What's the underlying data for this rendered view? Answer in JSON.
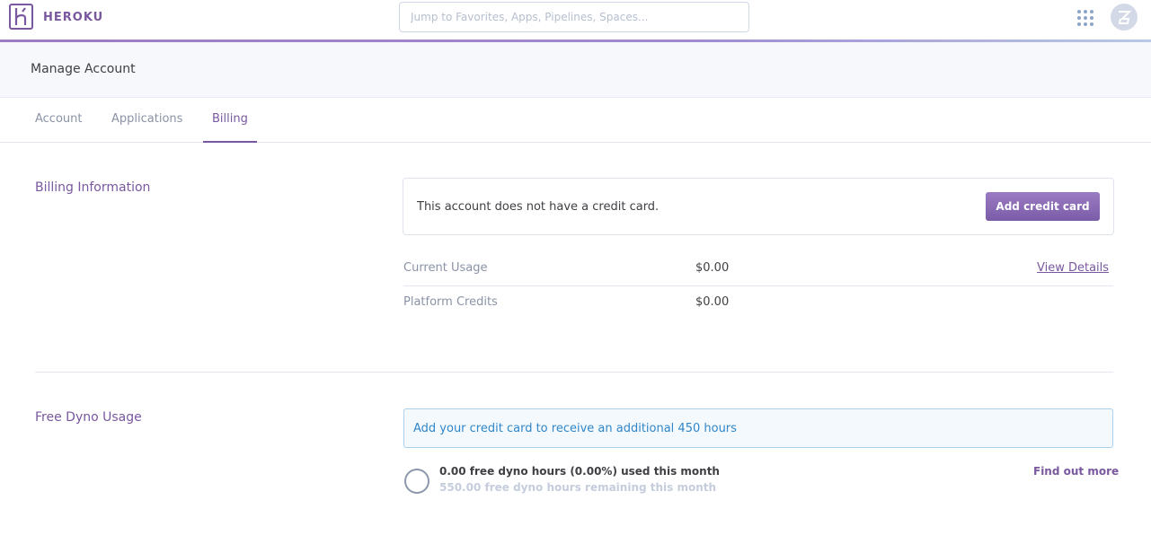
{
  "nav": {
    "brand": "HEROKU",
    "search_placeholder": "Jump to Favorites, Apps, Pipelines, Spaces...",
    "apps_icon": "grid-icon",
    "avatar_icon": "user-avatar-icon"
  },
  "header": {
    "title": "Manage Account"
  },
  "tabs": [
    {
      "label": "Account",
      "active": false
    },
    {
      "label": "Applications",
      "active": false
    },
    {
      "label": "Billing",
      "active": true
    }
  ],
  "billing": {
    "section_title": "Billing Information",
    "no_card_text": "This account does not have a credit card.",
    "add_card_label": "Add credit card",
    "rows": [
      {
        "label": "Current Usage",
        "value": "$0.00",
        "link": "View Details"
      },
      {
        "label": "Platform Credits",
        "value": "$0.00"
      }
    ]
  },
  "dyno": {
    "section_title": "Free Dyno Usage",
    "banner_text": "Add your credit card to receive an additional 450 hours",
    "used_text": "0.00 free dyno hours (0.00%) used this month",
    "remaining_text": "550.00 free dyno hours remaining this month",
    "used_fraction": 0.0,
    "find_out_more": "Find out more"
  },
  "colors": {
    "brand": "#79589f",
    "info": "#2f86c9"
  }
}
